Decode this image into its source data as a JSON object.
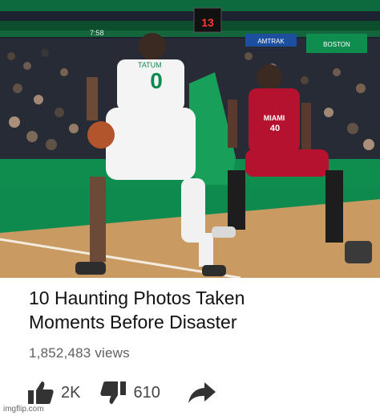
{
  "video": {
    "title_line1": "10 Haunting Photos Taken",
    "title_line2": "Moments Before Disaster",
    "views": "1,852,483 views"
  },
  "actions": {
    "like_count": "2K",
    "dislike_count": "610",
    "like_icon": "thumbs-up-icon",
    "dislike_icon": "thumbs-down-icon",
    "share_icon": "share-arrow-icon"
  },
  "thumbnail": {
    "shot_clock": "13",
    "game_clock": "7:58",
    "board_text_1": "BOSTON",
    "board_text_2": "AMTRAK",
    "left_player_name": "TATUM",
    "left_player_number": "0",
    "right_player_team": "MIAMI",
    "right_player_number": "40",
    "colors": {
      "celtics_green": "#0e8a4f",
      "heat_red": "#b5122f",
      "court_wood": "#c99a62"
    }
  },
  "watermark": "imgflip.com"
}
